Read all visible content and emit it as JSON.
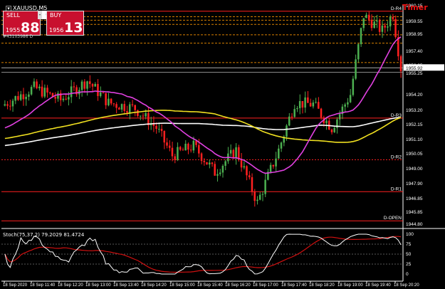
{
  "symbol": "XAUUSD,M5",
  "acct": "#43103986 D",
  "timer": "Timer",
  "sell": {
    "label": "SELL",
    "small": "1955",
    "big": "88"
  },
  "buy": {
    "label": "BUY",
    "small": "1956",
    "big": "13"
  },
  "lot": "0.02",
  "lot_minus": "-",
  "lot_plus": "+",
  "stoch_label": "Stoch(75,37,2) 79.2029 81.4724",
  "colors": {
    "bull": "#4caf50",
    "bear": "#ff2020",
    "ma1": "#e040e0",
    "ma2": "#f0e020",
    "ma3": "#ffffff",
    "level": "#ff2020",
    "orange": "#ff9800",
    "stoch_main": "#ffffff",
    "stoch_sig": "#d01010",
    "current": "#ffffff"
  },
  "price_axis": [
    "1960.15",
    "1959.55",
    "1958.95",
    "1957.40",
    "1956.35",
    "1955.25",
    "1954.20",
    "1953.20",
    "1952.15",
    "1951.10",
    "1950.05",
    "1949.00",
    "1947.90",
    "1946.85",
    "1945.85",
    "1944.80"
  ],
  "current_price": "1955.92",
  "stoch_axis": [
    "100",
    "75",
    "50",
    "25",
    "0"
  ],
  "pivot_labels": [
    {
      "text": "D-R4",
      "price": 1960.0
    },
    {
      "text": "D-R3",
      "price": 1952.3
    },
    {
      "text": "D-R2",
      "price": 1949.3
    },
    {
      "text": "D-R1",
      "price": 1947.0
    },
    {
      "text": "D-OPEN",
      "price": 1944.9
    }
  ],
  "time_axis": [
    "18 Sep 2020",
    "18 Sep 11:40",
    "18 Sep 12:20",
    "18 Sep 13:00",
    "18 Sep 13:40",
    "18 Sep 14:20",
    "18 Sep 15:00",
    "18 Sep 15:40",
    "18 Sep 16:20",
    "18 Sep 17:00",
    "18 Sep 17:40",
    "18 Sep 18:20",
    "18 Sep 19:00",
    "18 Sep 19:40",
    "18 Sep 20:20"
  ]
}
